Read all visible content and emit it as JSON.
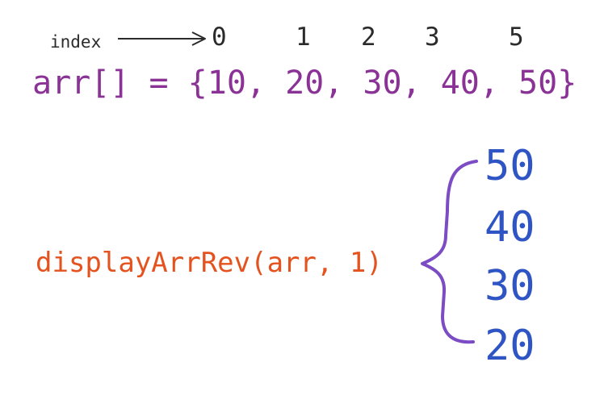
{
  "index_label": "index",
  "indices": [
    "0",
    "1",
    "2",
    "3",
    "5"
  ],
  "array_declaration": "arr[] = {10, 20, 30, 40, 50}",
  "function_call": "displayArrRev(arr, 1)",
  "outputs": [
    "50",
    "40",
    "30",
    "20"
  ],
  "colors": {
    "index_text": "#2b2b2b",
    "array_text": "#8a3296",
    "call_text": "#e4531f",
    "output_text": "#2f55c4",
    "brace": "#7b4cc4"
  }
}
